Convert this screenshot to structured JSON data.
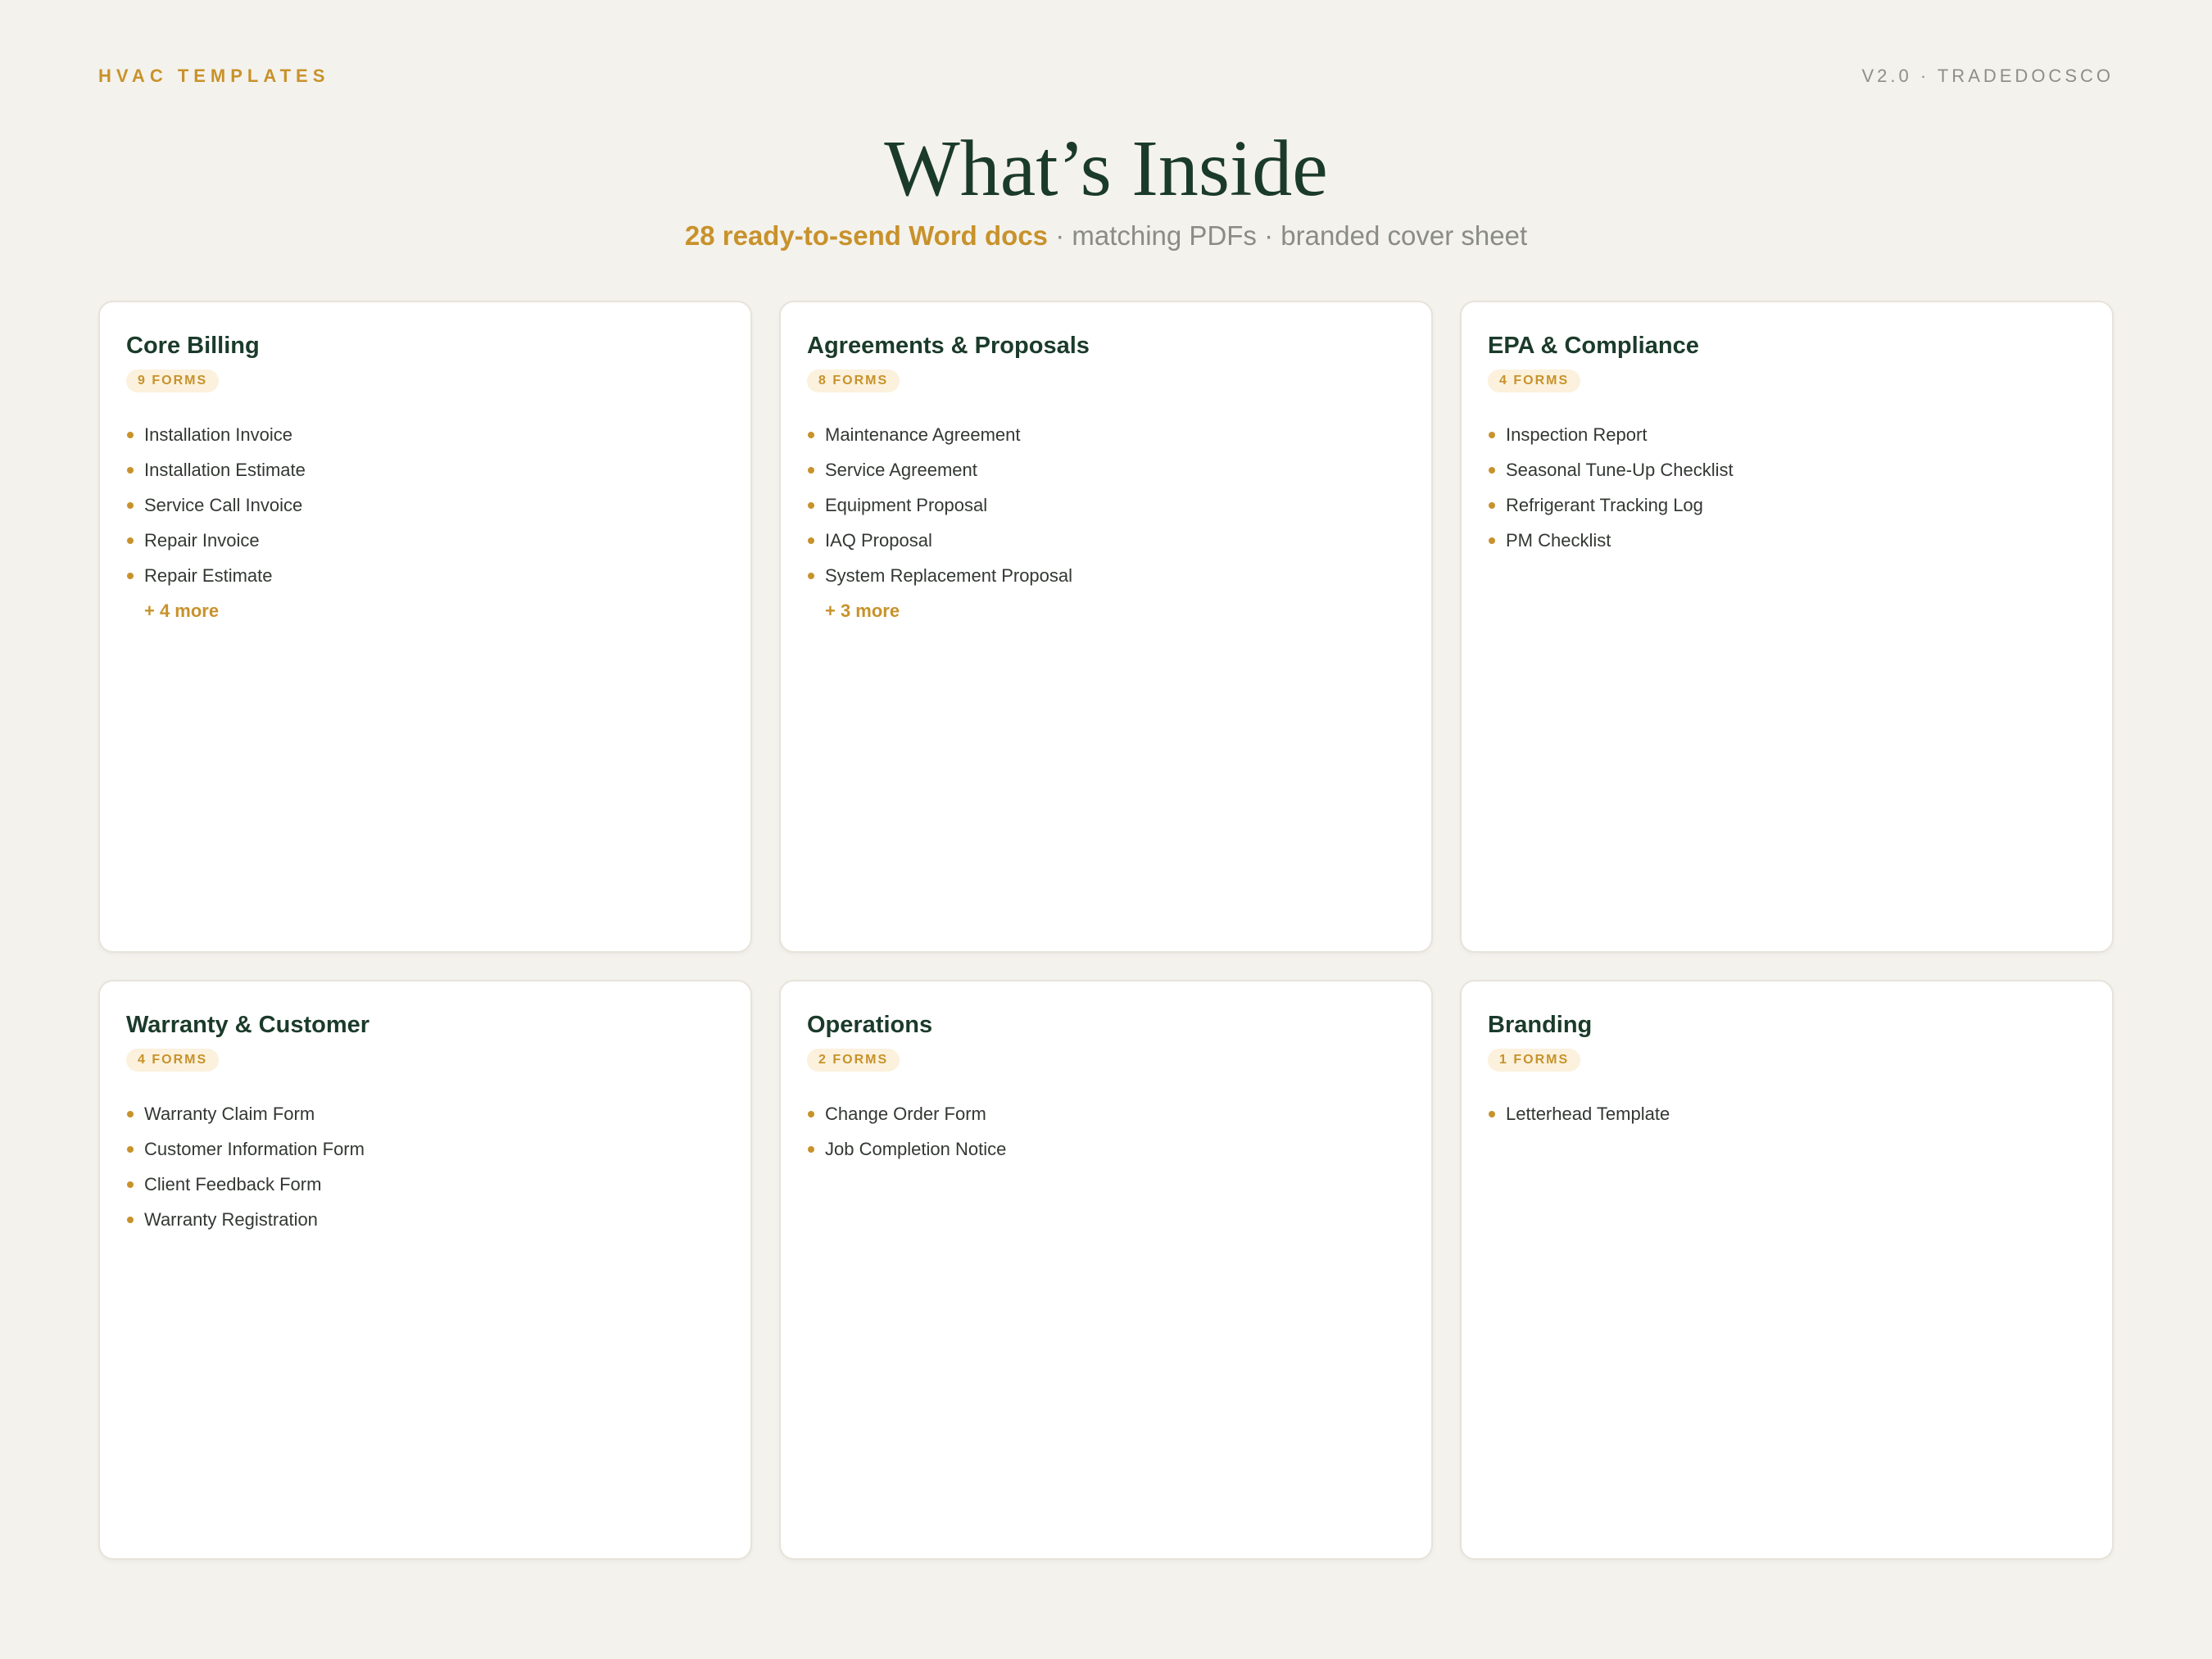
{
  "header": {
    "brand": "HVAC TEMPLATES",
    "version": "V2.0 · TRADEDOCSCO"
  },
  "hero": {
    "title": "What’s Inside",
    "subtitle_highlight": "28 ready-to-send Word docs",
    "subtitle_rest": " · matching PDFs · branded cover sheet"
  },
  "cards": [
    {
      "title": "Core Billing",
      "badge": "9 FORMS",
      "items": [
        "Installation Invoice",
        "Installation Estimate",
        "Service Call Invoice",
        "Repair Invoice",
        "Repair Estimate"
      ],
      "more": "+ 4 more"
    },
    {
      "title": "Agreements & Proposals",
      "badge": "8 FORMS",
      "items": [
        "Maintenance Agreement",
        "Service Agreement",
        "Equipment Proposal",
        "IAQ Proposal",
        "System Replacement Proposal"
      ],
      "more": "+ 3 more"
    },
    {
      "title": "EPA & Compliance",
      "badge": "4 FORMS",
      "items": [
        "Inspection Report",
        "Seasonal Tune-Up Checklist",
        "Refrigerant Tracking Log",
        "PM Checklist"
      ],
      "more": ""
    },
    {
      "title": "Warranty & Customer",
      "badge": "4 FORMS",
      "items": [
        "Warranty Claim Form",
        "Customer Information Form",
        "Client Feedback Form",
        "Warranty Registration"
      ],
      "more": ""
    },
    {
      "title": "Operations",
      "badge": "2 FORMS",
      "items": [
        "Change Order Form",
        "Job Completion Notice"
      ],
      "more": ""
    },
    {
      "title": "Branding",
      "badge": "1 FORMS",
      "items": [
        "Letterhead Template"
      ],
      "more": ""
    }
  ],
  "colors": {
    "accent": "#c8922b",
    "heading": "#1b3b2a",
    "background": "#f4f2ed",
    "card": "#ffffff"
  }
}
